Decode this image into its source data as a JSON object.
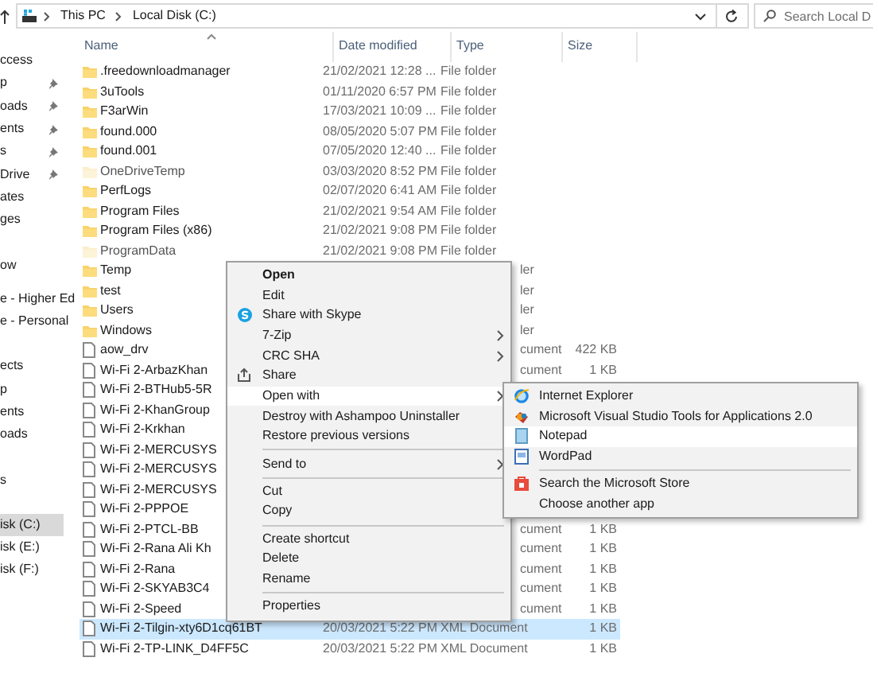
{
  "address_bar": {
    "path": [
      "This PC",
      "Local Disk (C:)"
    ]
  },
  "search": {
    "placeholder": "Search Local D"
  },
  "columns": [
    {
      "label": "Name",
      "sorted": true
    },
    {
      "label": "Date modified",
      "sorted": false
    },
    {
      "label": "Type",
      "sorted": false
    },
    {
      "label": "Size",
      "sorted": false
    }
  ],
  "sidebar": {
    "groups": [
      [
        {
          "label": "ccess",
          "pinned": false,
          "selected": false
        },
        {
          "label": "p",
          "pinned": true,
          "selected": false
        },
        {
          "label": "oads",
          "pinned": true,
          "selected": false
        },
        {
          "label": "ents",
          "pinned": true,
          "selected": false
        },
        {
          "label": "s",
          "pinned": true,
          "selected": false
        },
        {
          "label": "Drive",
          "pinned": true,
          "selected": false
        },
        {
          "label": "ates",
          "pinned": false,
          "selected": false
        },
        {
          "label": "ges",
          "pinned": false,
          "selected": false
        }
      ],
      [
        {
          "label": "ow",
          "pinned": false,
          "selected": false
        }
      ],
      [
        {
          "label": "e - Higher Ed",
          "pinned": false,
          "selected": false
        },
        {
          "label": "e - Personal",
          "pinned": false,
          "selected": false
        }
      ],
      [
        {
          "label": "ects",
          "pinned": false,
          "selected": false
        },
        {
          "label": "p",
          "pinned": false,
          "selected": false
        },
        {
          "label": "ents",
          "pinned": false,
          "selected": false
        },
        {
          "label": "oads",
          "pinned": false,
          "selected": false
        }
      ],
      [
        {
          "label": "s",
          "pinned": false,
          "selected": false
        }
      ],
      [
        {
          "label": "isk (C:)",
          "pinned": false,
          "selected": true
        },
        {
          "label": "isk (E:)",
          "pinned": false,
          "selected": false
        },
        {
          "label": "isk (F:)",
          "pinned": false,
          "selected": false
        }
      ]
    ]
  },
  "files": [
    {
      "kind": "folder",
      "name": ".freedownloadmanager",
      "date": "21/02/2021 12:28 ...",
      "type": "File folder",
      "hidden": false,
      "selected": false
    },
    {
      "kind": "folder",
      "name": "3uTools",
      "date": "01/11/2020 6:57 PM",
      "type": "File folder",
      "hidden": false,
      "selected": false
    },
    {
      "kind": "folder",
      "name": "F3arWin",
      "date": "17/03/2021 10:09 ...",
      "type": "File folder",
      "hidden": false,
      "selected": false
    },
    {
      "kind": "folder",
      "name": "found.000",
      "date": "08/05/2020 5:07 PM",
      "type": "File folder",
      "hidden": false,
      "selected": false
    },
    {
      "kind": "folder",
      "name": "found.001",
      "date": "07/05/2020 12:40 ...",
      "type": "File folder",
      "hidden": false,
      "selected": false
    },
    {
      "kind": "folder",
      "name": "OneDriveTemp",
      "date": "03/03/2020 8:52 PM",
      "type": "File folder",
      "hidden": true,
      "selected": false
    },
    {
      "kind": "folder",
      "name": "PerfLogs",
      "date": "02/07/2020 6:41 AM",
      "type": "File folder",
      "hidden": false,
      "selected": false
    },
    {
      "kind": "folder",
      "name": "Program Files",
      "date": "21/02/2021 9:54 AM",
      "type": "File folder",
      "hidden": false,
      "selected": false
    },
    {
      "kind": "folder",
      "name": "Program Files (x86)",
      "date": "21/02/2021 9:08 PM",
      "type": "File folder",
      "hidden": false,
      "selected": false
    },
    {
      "kind": "folder",
      "name": "ProgramData",
      "date": "21/02/2021 9:08 PM",
      "type": "File folder",
      "hidden": true,
      "selected": false
    },
    {
      "kind": "folder",
      "name": "Temp",
      "type": "ler",
      "hidden": false,
      "selected": false,
      "under_menu": true
    },
    {
      "kind": "folder",
      "name": "test",
      "type": "ler",
      "hidden": false,
      "selected": false,
      "under_menu": true
    },
    {
      "kind": "folder",
      "name": "Users",
      "type": "ler",
      "hidden": false,
      "selected": false,
      "under_menu": true
    },
    {
      "kind": "folder",
      "name": "Windows",
      "type": "ler",
      "hidden": false,
      "selected": false,
      "under_menu": true
    },
    {
      "kind": "file",
      "name": "aow_drv",
      "type": "cument",
      "size": "422 KB",
      "selected": false,
      "under_menu": true
    },
    {
      "kind": "file",
      "name": "Wi-Fi 2-ArbazKhan",
      "type": "cument",
      "size": "1 KB",
      "selected": false,
      "under_menu": true
    },
    {
      "kind": "file",
      "name": "Wi-Fi 2-BTHub5-5R",
      "selected": false
    },
    {
      "kind": "file",
      "name": "Wi-Fi 2-KhanGroup",
      "selected": false
    },
    {
      "kind": "file",
      "name": "Wi-Fi 2-Krkhan",
      "selected": false
    },
    {
      "kind": "file",
      "name": "Wi-Fi 2-MERCUSYS",
      "selected": false
    },
    {
      "kind": "file",
      "name": "Wi-Fi 2-MERCUSYS",
      "selected": false
    },
    {
      "kind": "file",
      "name": "Wi-Fi 2-MERCUSYS",
      "selected": false
    },
    {
      "kind": "file",
      "name": "Wi-Fi 2-PPPOE",
      "selected": false
    },
    {
      "kind": "file",
      "name": "Wi-Fi 2-PTCL-BB",
      "type": "cument",
      "size": "1 KB",
      "selected": false,
      "under_menu": true
    },
    {
      "kind": "file",
      "name": "Wi-Fi 2-Rana Ali Kh",
      "type": "cument",
      "size": "1 KB",
      "selected": false,
      "under_menu": true
    },
    {
      "kind": "file",
      "name": "Wi-Fi 2-Rana",
      "type": "cument",
      "size": "1 KB",
      "selected": false,
      "under_menu": true
    },
    {
      "kind": "file",
      "name": "Wi-Fi 2-SKYAB3C4",
      "type": "cument",
      "size": "1 KB",
      "selected": false,
      "under_menu": true
    },
    {
      "kind": "file",
      "name": "Wi-Fi 2-Speed",
      "type": "cument",
      "size": "1 KB",
      "selected": false,
      "under_menu": true
    },
    {
      "kind": "file",
      "name": "Wi-Fi 2-Tilgin-xty6D1cq61BT",
      "date": "20/03/2021 5:22 PM",
      "type": "XML Document",
      "size": "1 KB",
      "selected": true
    },
    {
      "kind": "file",
      "name": "Wi-Fi 2-TP-LINK_D4FF5C",
      "date": "20/03/2021 5:22 PM",
      "type": "XML Document",
      "size": "1 KB",
      "selected": false
    }
  ],
  "context_menu": {
    "items": [
      {
        "label": "Open",
        "default": true,
        "submenu": false,
        "highlighted": false,
        "separator_before": false
      },
      {
        "label": "Edit",
        "default": false,
        "submenu": false,
        "highlighted": false,
        "separator_before": false
      },
      {
        "label": "Share with Skype",
        "default": false,
        "submenu": false,
        "highlighted": false,
        "separator_before": false
      },
      {
        "label": "7-Zip",
        "default": false,
        "submenu": true,
        "highlighted": false,
        "separator_before": false
      },
      {
        "label": "CRC SHA",
        "default": false,
        "submenu": true,
        "highlighted": false,
        "separator_before": false
      },
      {
        "label": "Share",
        "default": false,
        "submenu": false,
        "highlighted": false,
        "separator_before": false
      },
      {
        "label": "Open with",
        "default": false,
        "submenu": true,
        "highlighted": true,
        "separator_before": false
      },
      {
        "label": "Destroy with Ashampoo Uninstaller",
        "default": false,
        "submenu": false,
        "highlighted": false,
        "separator_before": false
      },
      {
        "label": "Restore previous versions",
        "default": false,
        "submenu": false,
        "highlighted": false,
        "separator_before": false
      },
      {
        "label": "Send to",
        "default": false,
        "submenu": true,
        "highlighted": false,
        "separator_before": true
      },
      {
        "label": "Cut",
        "default": false,
        "submenu": false,
        "highlighted": false,
        "separator_before": true
      },
      {
        "label": "Copy",
        "default": false,
        "submenu": false,
        "highlighted": false,
        "separator_before": false
      },
      {
        "label": "Create shortcut",
        "default": false,
        "submenu": false,
        "highlighted": false,
        "separator_before": true
      },
      {
        "label": "Delete",
        "default": false,
        "submenu": false,
        "highlighted": false,
        "separator_before": false
      },
      {
        "label": "Rename",
        "default": false,
        "submenu": false,
        "highlighted": false,
        "separator_before": false
      },
      {
        "label": "Properties",
        "default": false,
        "submenu": false,
        "highlighted": false,
        "separator_before": true
      }
    ]
  },
  "open_with_menu": {
    "items": [
      {
        "label": "Internet Explorer",
        "highlighted": false,
        "separator_before": false
      },
      {
        "label": "Microsoft Visual Studio Tools for Applications 2.0",
        "highlighted": false,
        "separator_before": false
      },
      {
        "label": "Notepad",
        "highlighted": true,
        "separator_before": false
      },
      {
        "label": "WordPad",
        "highlighted": false,
        "separator_before": false
      },
      {
        "label": "Search the Microsoft Store",
        "highlighted": false,
        "separator_before": true
      },
      {
        "label": "Choose another app",
        "highlighted": false,
        "separator_before": false
      }
    ]
  }
}
